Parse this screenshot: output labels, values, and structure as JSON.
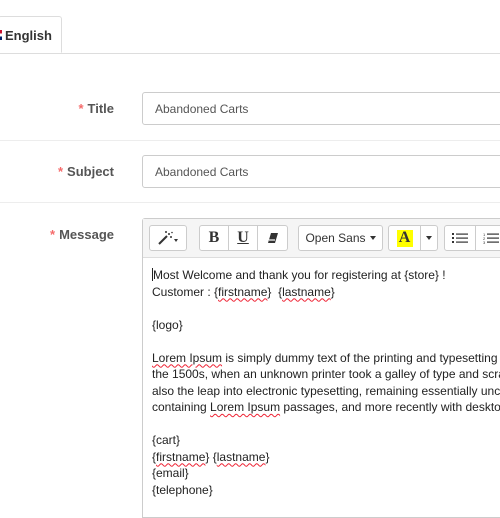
{
  "tabs": [
    {
      "label": "English",
      "flag": "flag-uk-icon"
    }
  ],
  "form": {
    "title": {
      "label": "Title",
      "required_mark": "*",
      "value": "Abandoned Carts"
    },
    "subject": {
      "label": "Subject",
      "required_mark": "*",
      "value": "Abandoned Carts"
    },
    "message": {
      "label": "Message",
      "required_mark": "*"
    }
  },
  "toolbar": {
    "magic_icon": "magic-wand-icon",
    "bold": "B",
    "underline": "U",
    "eraser_icon": "eraser-icon",
    "font": "Open Sans",
    "color_letter": "A",
    "color_highlight": "#ffff00",
    "unordered_list_icon": "unordered-list-icon",
    "ordered_list_icon": "ordered-list-icon"
  },
  "editor": {
    "line1": "Most Welcome and thank you for registering at {store} !",
    "line2a": "Customer : {",
    "line2b": "firstname",
    "line2c": "}  {",
    "line2d": "lastname",
    "line2e": "}",
    "logo": "{logo}",
    "para": [
      {
        "a": "Lorem Ipsum",
        "b": " is simply dummy text of the printing and typesetting"
      },
      {
        "a": "",
        "b": "the 1500s, when an unknown printer took a galley of type and scra"
      },
      {
        "a": "",
        "b": "also the leap into electronic typesetting, remaining essentially unc"
      },
      {
        "a": "containing ",
        "sq": "Lorem Ipsum",
        "b": " passages, and more recently with desktop"
      }
    ],
    "cart": "{cart}",
    "fl1": "firstname",
    "fl2": "} {",
    "fl3": "lastname",
    "fl4": "}",
    "email": "{email}",
    "telephone": "{telephone}"
  }
}
